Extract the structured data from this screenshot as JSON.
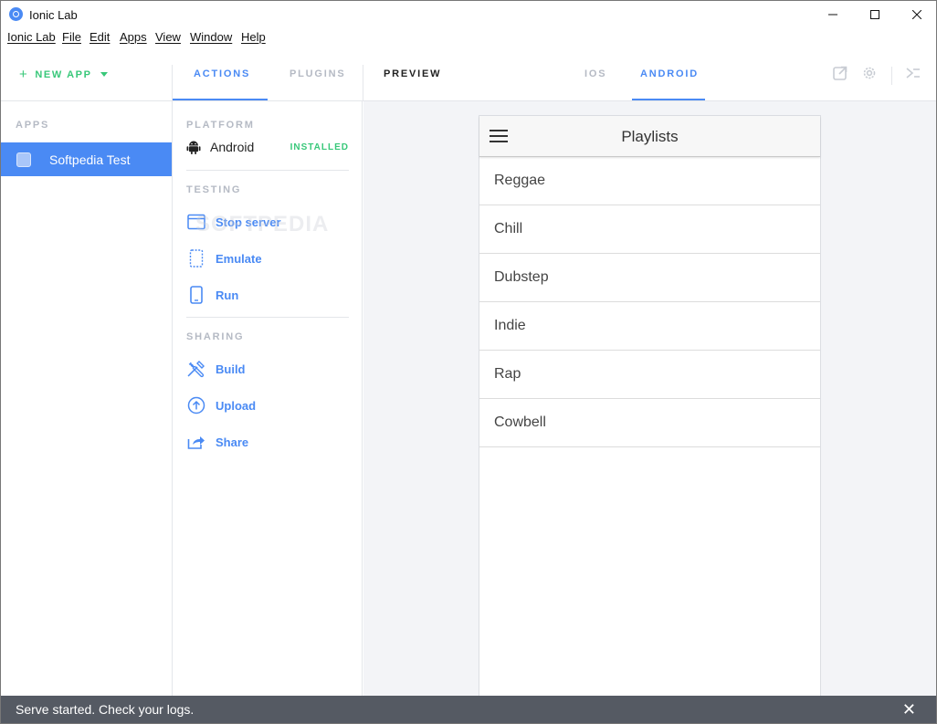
{
  "window": {
    "title": "Ionic Lab",
    "controls": {
      "minimize": "—",
      "maximize": "☐",
      "close": "✕"
    }
  },
  "menu": [
    "Ionic Lab",
    "File",
    "Edit",
    "Apps",
    "View",
    "Window",
    "Help"
  ],
  "toolbar": {
    "new_app": "NEW APP",
    "tabs": {
      "actions": "ACTIONS",
      "plugins": "PLUGINS",
      "preview": "PREVIEW",
      "ios": "IOS",
      "android": "ANDROID"
    },
    "active_tab": "actions",
    "active_platform": "android",
    "icons": [
      "external-link-icon",
      "gear-icon",
      "terminal-icon"
    ]
  },
  "sidebar": {
    "section_label": "APPS",
    "apps": [
      {
        "name": "Softpedia Test",
        "selected": true
      }
    ]
  },
  "actions": {
    "platform": {
      "label": "PLATFORM",
      "name": "Android",
      "status": "INSTALLED"
    },
    "testing": {
      "label": "TESTING",
      "items": [
        {
          "label": "Stop server",
          "icon": "browser-window-icon"
        },
        {
          "label": "Emulate",
          "icon": "dashed-device-icon"
        },
        {
          "label": "Run",
          "icon": "phone-icon"
        }
      ]
    },
    "sharing": {
      "label": "SHARING",
      "items": [
        {
          "label": "Build",
          "icon": "tools-icon"
        },
        {
          "label": "Upload",
          "icon": "upload-icon"
        },
        {
          "label": "Share",
          "icon": "share-icon"
        }
      ]
    }
  },
  "preview": {
    "header_title": "Playlists",
    "playlists": [
      "Reggae",
      "Chill",
      "Dubstep",
      "Indie",
      "Rap",
      "Cowbell"
    ]
  },
  "status": {
    "message": "Serve started. Check your logs.",
    "close": "✕"
  },
  "watermark": "SOFTPEDIA",
  "colors": {
    "accent": "#4a8af4",
    "success": "#39c87a",
    "muted": "#b5bac4",
    "statusbar": "#555a63"
  }
}
